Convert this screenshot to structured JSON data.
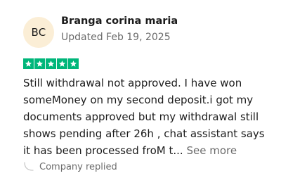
{
  "review": {
    "avatar_initials": "BC",
    "reviewer_name": "Branga corina maria",
    "date": "Updated Feb 19, 2025",
    "rating": 5,
    "star_color": "#00b67a",
    "avatar_color": "#fbeed6",
    "body_lines": [
      "Still withdrawal not approved. I have won",
      "someMoney on my second deposit.i got my",
      "documents approved but my withdrawal still",
      "shows pending after 26h , chat assistant says",
      "it has been processed froM t..."
    ],
    "see_more_label": "See more",
    "company_replied_label": "Company replied",
    "company_replied_icon": "reply-arrow-icon"
  }
}
